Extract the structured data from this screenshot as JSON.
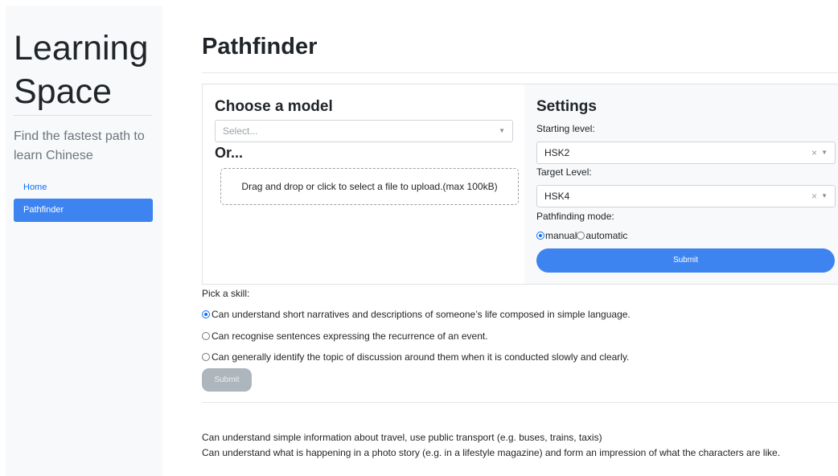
{
  "sidebar": {
    "brand_line1": "Learning",
    "brand_line2": "Space",
    "tagline": "Find the fastest path to learn Chinese",
    "nav": [
      {
        "label": "Home",
        "active": false
      },
      {
        "label": "Pathfinder",
        "active": true
      }
    ]
  },
  "main": {
    "title": "Pathfinder",
    "model": {
      "heading": "Choose a model",
      "select_placeholder": "Select...",
      "or_label": "Or...",
      "upload_text": "Drag and drop or click to select a file to upload.(max 100kB)"
    },
    "settings": {
      "heading": "Settings",
      "starting_level_label": "Starting level:",
      "starting_level_value": "HSK2",
      "target_level_label": "Target Level:",
      "target_level_value": "HSK4",
      "mode_label": "Pathfinding mode:",
      "mode_options": [
        {
          "label": "manual",
          "selected": true
        },
        {
          "label": "automatic",
          "selected": false
        }
      ],
      "submit_label": "Submit"
    },
    "skills": {
      "prompt": "Pick a skill:",
      "options": [
        {
          "label": "Can understand short narratives and descriptions of someone’s life composed in simple language.",
          "selected": true
        },
        {
          "label": "Can recognise sentences expressing the recurrence of an event.",
          "selected": false
        },
        {
          "label": "Can generally identify the topic of discussion around them when it is conducted slowly and clearly.",
          "selected": false
        }
      ],
      "submit_label": "Submit"
    },
    "results": [
      "Can understand simple information about travel, use public transport (e.g. buses, trains, taxis)",
      "Can understand what is happening in a photo story (e.g. in a lifestyle magazine) and form an impression of what the characters are like."
    ]
  },
  "colors": {
    "accent": "#3d84f0",
    "disabled": "#adb5bd",
    "sidebar_bg": "#f8f9fa"
  },
  "icons": {
    "select_caret": "chevron-down-icon",
    "select_clear": "close-icon"
  }
}
